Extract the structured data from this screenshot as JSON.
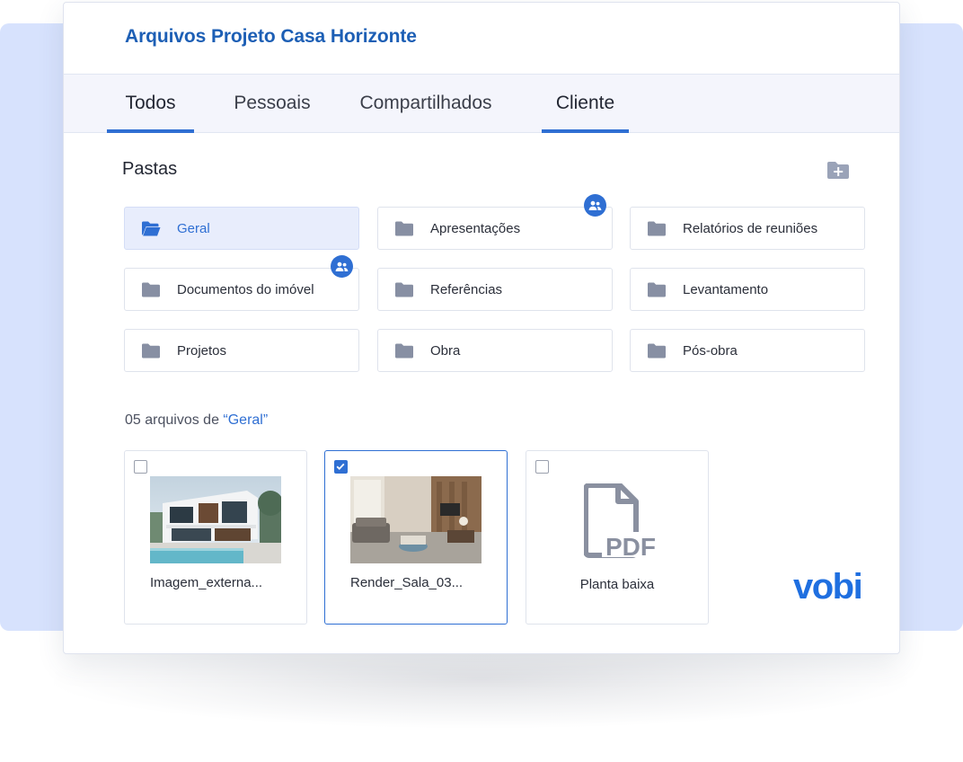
{
  "header": {
    "title": "Arquivos Projeto Casa Horizonte"
  },
  "tabs": [
    {
      "label": "Todos",
      "active": true
    },
    {
      "label": "Pessoais",
      "active": false
    },
    {
      "label": "Compartilhados",
      "active": false
    },
    {
      "label": "Cliente",
      "active": true
    }
  ],
  "folders_section": {
    "title": "Pastas",
    "new_folder_icon": "folder-plus-icon",
    "folders": [
      {
        "label": "Geral",
        "active": true,
        "shared": false
      },
      {
        "label": "Apresentações",
        "active": false,
        "shared": true
      },
      {
        "label": "Relatórios de reuniões",
        "active": false,
        "shared": false
      },
      {
        "label": "Documentos do imóvel",
        "active": false,
        "shared": true
      },
      {
        "label": "Referências",
        "active": false,
        "shared": false
      },
      {
        "label": "Levantamento",
        "active": false,
        "shared": false
      },
      {
        "label": "Projetos",
        "active": false,
        "shared": false
      },
      {
        "label": "Obra",
        "active": false,
        "shared": false
      },
      {
        "label": "Pós-obra",
        "active": false,
        "shared": false
      }
    ]
  },
  "files_section": {
    "count_text": "05 arquivos de ",
    "folder_ref": "“Geral”",
    "files": [
      {
        "name": "Imagem_externa...",
        "selected": false,
        "kind": "image"
      },
      {
        "name": "Render_Sala_03...",
        "selected": true,
        "kind": "image"
      },
      {
        "name": "Planta baixa",
        "selected": false,
        "kind": "pdf"
      }
    ]
  },
  "pdf_icon_text": "PDF",
  "brand": {
    "logo_text": "vobi"
  },
  "colors": {
    "accent": "#2f6fd3",
    "title": "#1d5fb5",
    "background_panel": "#d7e2fd",
    "brand": "#1f6fe0"
  }
}
